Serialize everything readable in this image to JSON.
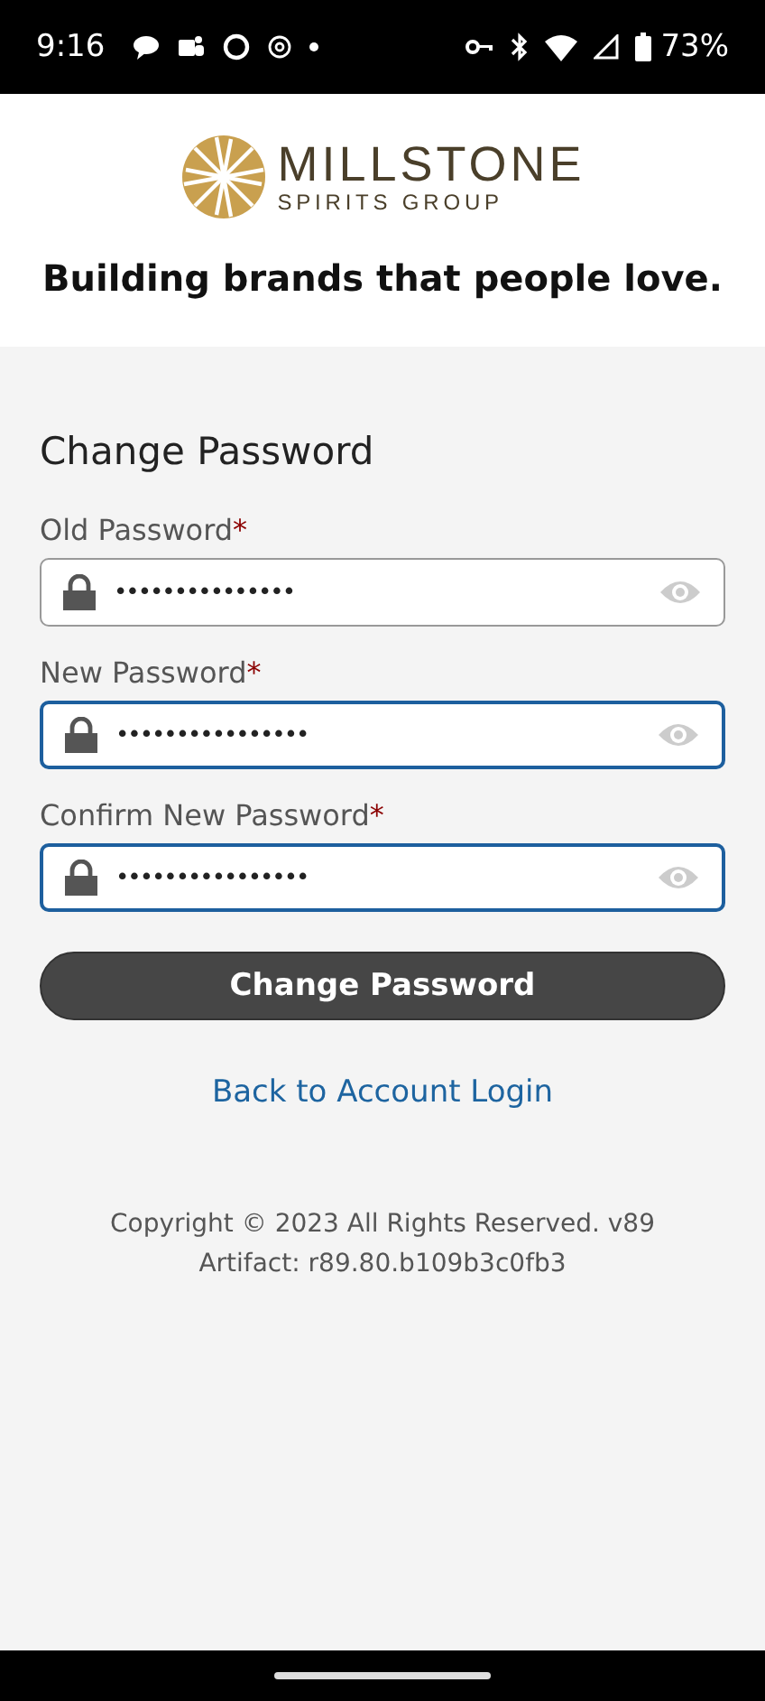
{
  "status_bar": {
    "time": "9:16",
    "battery": "73%"
  },
  "header": {
    "brand": "MILLSTONE",
    "brand_sub": "SPIRITS GROUP",
    "tagline": "Building brands that people love."
  },
  "form": {
    "title": "Change Password",
    "fields": [
      {
        "label": "Old Password",
        "required_mark": "*",
        "value": "•••••••••••••••",
        "highlighted": false
      },
      {
        "label": "New Password",
        "required_mark": "*",
        "value": "••••••••••••••••",
        "highlighted": true
      },
      {
        "label": "Confirm New Password",
        "required_mark": "*",
        "value": "••••••••••••••••",
        "highlighted": true
      }
    ],
    "submit": "Change Password",
    "link": "Back to Account Login"
  },
  "footer": {
    "copyright": "Copyright © 2023 All Rights Reserved. v89 Artifact: r89.80.b109b3c0fb3"
  }
}
